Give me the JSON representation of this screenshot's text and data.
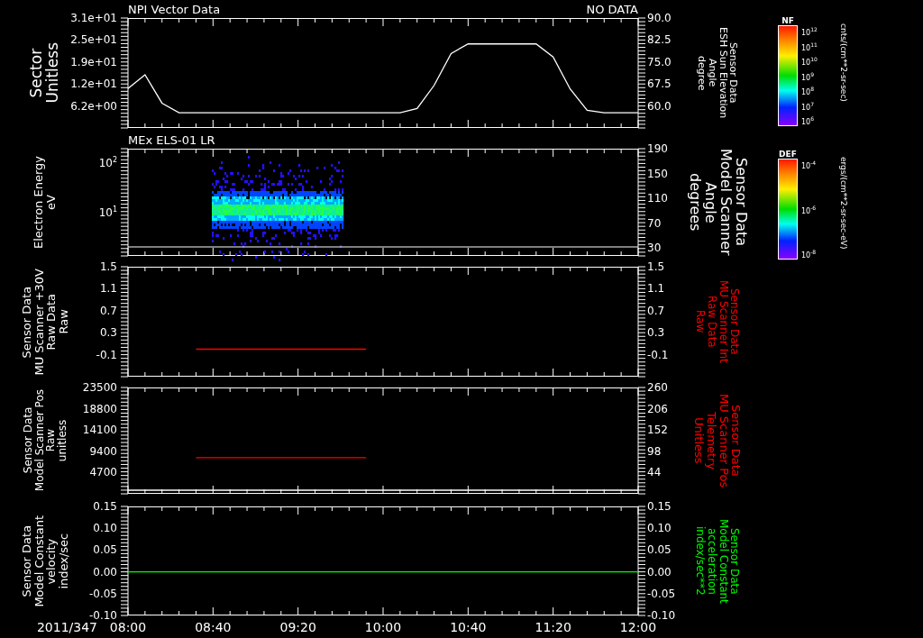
{
  "panels": [
    {
      "kind": "line",
      "status": "NO DATA",
      "left_label": [
        "Sector",
        "Unitless"
      ],
      "right_label": {
        "lines": [
          "Sensor Data",
          "ESH Sun Elevation",
          "Angle",
          "degree"
        ],
        "color": "#ffffff"
      },
      "right_ticks": [
        "90.0",
        "82.5",
        "75.0",
        "67.5",
        "60.0"
      ],
      "chart_data": {
        "type": "line",
        "title": "NPI Vector Data",
        "categories": [
          null,
          null,
          null,
          null,
          null,
          null,
          null,
          null,
          null,
          null,
          null,
          null,
          null,
          null,
          null,
          null,
          null,
          null,
          null,
          null,
          null,
          null,
          null,
          null,
          null,
          null,
          null,
          null,
          null,
          null,
          null
        ],
        "ylim": [
          0,
          31
        ],
        "yticks": [
          {
            "value": 31,
            "label": "3.1e+01"
          },
          {
            "value": 24.8,
            "label": "2.5e+01"
          },
          {
            "value": 18.6,
            "label": "1.9e+01"
          },
          {
            "value": 12.4,
            "label": "1.2e+01"
          },
          {
            "value": 6.2,
            "label": "6.2e+00"
          }
        ],
        "series": [
          {
            "color": "#ffffff",
            "values": [
              11.1,
              15,
              7,
              4.3,
              4.3,
              4.3,
              4.3,
              4.3,
              4.3,
              4.3,
              4.3,
              4.3,
              4.3,
              4.3,
              4.3,
              4.3,
              4.3,
              5.5,
              12,
              21,
              23.7,
              23.7,
              23.7,
              23.7,
              23.7,
              20,
              11,
              5,
              4.3,
              4.3,
              4.3
            ]
          }
        ]
      }
    },
    {
      "kind": "spectrogram",
      "title": "MEx ELS-01 LR",
      "left_label": [
        "Electron Energy",
        "eV"
      ],
      "right_label": {
        "lines": [
          "Sensor Data",
          "Model Scanner",
          "Angle",
          "degrees"
        ],
        "color": "#ffffff"
      },
      "left_ticks": [
        "10$^{2}$",
        "10$^{1}$"
      ],
      "right_ticks": [
        "190",
        "150",
        "110",
        "70",
        "30"
      ]
    },
    {
      "kind": "line",
      "left_label": [
        "Sensor Data",
        "MU Scanner +30V",
        "Raw Data",
        "Raw"
      ],
      "right_label": {
        "lines": [
          "Sensor Data",
          "MU Scanner Int",
          "Raw Data",
          "Raw"
        ],
        "color": "#ff0000"
      },
      "right_ticks": [
        "1.5",
        "1.1",
        "0.7",
        "0.3",
        "-0.1"
      ],
      "chart_data": {
        "type": "line",
        "categories": [
          null,
          null,
          null,
          null,
          null,
          null,
          null,
          null,
          null,
          null,
          null,
          null,
          null,
          null,
          null,
          null,
          null,
          null,
          null,
          null,
          null,
          null,
          null,
          null,
          null,
          null,
          null,
          null,
          null,
          null,
          null
        ],
        "ylim": [
          -0.5,
          1.5
        ],
        "yticks": [
          {
            "value": 1.5,
            "label": "1.5"
          },
          {
            "value": 1.1,
            "label": "1.1"
          },
          {
            "value": 0.7,
            "label": "0.7"
          },
          {
            "value": 0.3,
            "label": "0.3"
          },
          {
            "value": -0.1,
            "label": "-0.1"
          }
        ],
        "series": [
          {
            "color": "#ff0000",
            "values": [
              null,
              null,
              null,
              null,
              0,
              0,
              0,
              0,
              0,
              0,
              0,
              0,
              0,
              0,
              0,
              null,
              null,
              null,
              null,
              null,
              null,
              null,
              null,
              null,
              null,
              null,
              null,
              null,
              null,
              null,
              null
            ]
          }
        ]
      }
    },
    {
      "kind": "line",
      "left_label": [
        "Sensor Data",
        "Model Scanner Pos",
        "Raw",
        "unitless"
      ],
      "right_label": {
        "lines": [
          "Sensor Data",
          "MU Scanner Pos",
          "Telemetry",
          "Unitless"
        ],
        "color": "#ff0000"
      },
      "right_ticks": [
        "260",
        "206",
        "152",
        "98",
        "44"
      ],
      "chart_data": {
        "type": "line",
        "categories": [
          null,
          null,
          null,
          null,
          null,
          null,
          null,
          null,
          null,
          null,
          null,
          null,
          null,
          null,
          null,
          null,
          null,
          null,
          null,
          null,
          null,
          null,
          null,
          null,
          null,
          null,
          null,
          null,
          null,
          null,
          null
        ],
        "ylim": [
          0,
          23500
        ],
        "yticks": [
          {
            "value": 23500,
            "label": "23500"
          },
          {
            "value": 18800,
            "label": "18800"
          },
          {
            "value": 14100,
            "label": "14100"
          },
          {
            "value": 9400,
            "label": "9400"
          },
          {
            "value": 4700,
            "label": "4700"
          }
        ],
        "series": [
          {
            "color": "#ff0000",
            "values": [
              null,
              null,
              null,
              null,
              8000,
              8000,
              8000,
              8000,
              8000,
              8000,
              8000,
              8000,
              8000,
              8000,
              8000,
              null,
              null,
              null,
              null,
              null,
              null,
              null,
              null,
              null,
              null,
              null,
              null,
              null,
              null,
              null,
              null
            ]
          },
          {
            "color": "#ffffff",
            "values": [
              800,
              800,
              800,
              800,
              800,
              800,
              800,
              800,
              800,
              800,
              800,
              800,
              800,
              800,
              800,
              800,
              800,
              800,
              800,
              800,
              800,
              800,
              800,
              800,
              800,
              800,
              800,
              800,
              800,
              800,
              800
            ]
          }
        ]
      }
    },
    {
      "kind": "line",
      "left_label": [
        "Sensor Data",
        "Model Constant",
        "velocity",
        "index/sec"
      ],
      "right_label": {
        "lines": [
          "Sensor Data",
          "Model Constant",
          "acceleration",
          "index/sec**2"
        ],
        "color": "#00ff00"
      },
      "right_ticks": [
        "0.15",
        "0.10",
        "0.05",
        "0.00",
        "-0.05",
        "-0.10"
      ],
      "chart_data": {
        "type": "line",
        "categories": [
          null,
          null,
          null,
          null,
          null,
          null,
          null,
          null,
          null,
          null,
          null,
          null,
          null,
          null,
          null,
          null,
          null,
          null,
          null,
          null,
          null,
          null,
          null,
          null,
          null,
          null,
          null,
          null,
          null,
          null,
          null
        ],
        "ylim": [
          -0.1,
          0.15
        ],
        "yticks": [
          {
            "value": 0.15,
            "label": "0.15"
          },
          {
            "value": 0.1,
            "label": "0.10"
          },
          {
            "value": 0.05,
            "label": "0.05"
          },
          {
            "value": 0,
            "label": "0.00"
          },
          {
            "value": -0.05,
            "label": "-0.05"
          },
          {
            "value": -0.1,
            "label": "-0.10"
          }
        ],
        "series": [
          {
            "color": "#00ff00",
            "values": [
              0,
              0,
              0,
              0,
              0,
              0,
              0,
              0,
              0,
              0,
              0,
              0,
              0,
              0,
              0,
              0,
              0,
              0,
              0,
              0,
              0,
              0,
              0,
              0,
              0,
              0,
              0,
              0,
              0,
              0,
              0
            ]
          }
        ]
      }
    }
  ],
  "time_axis": {
    "date": "2011/347",
    "labels": [
      "08:00",
      "08:40",
      "09:20",
      "10:00",
      "10:40",
      "11:20",
      "12:00"
    ]
  },
  "color_scales": [
    {
      "title": "NF",
      "ticks": [
        "10$^{12}$",
        "10$^{11}$",
        "10$^{10}$",
        "10$^{9}$",
        "10$^{8}$",
        "10$^{7}$",
        "10$^{6}$"
      ],
      "units": "cnts/(cm**2-sr-sec)"
    },
    {
      "title": "DEF",
      "ticks": [
        "10$^{-4}$",
        "10$^{-6}$",
        "10$^{-8}$"
      ],
      "units": "ergs/(cm**2-sr-sec-eV)"
    }
  ]
}
